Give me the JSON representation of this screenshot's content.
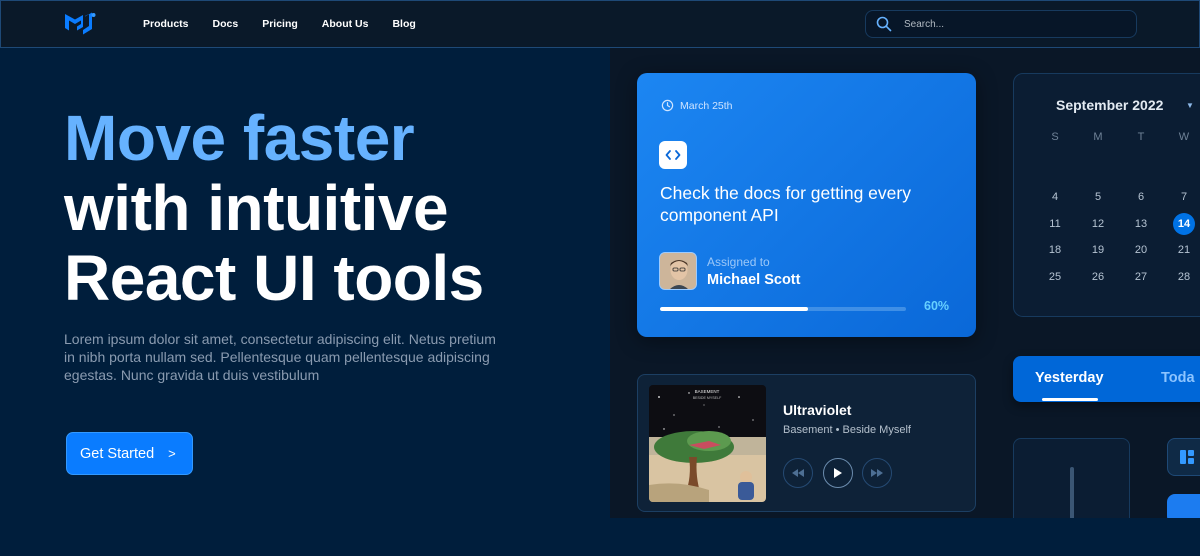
{
  "colors": {
    "background": "#001e3c",
    "accent": "#66b2ff",
    "primary": "#0a7cff",
    "header": "#0a1929"
  },
  "header": {
    "logo_icon": "mui-logo-icon",
    "nav": [
      "Products",
      "Docs",
      "Pricing",
      "About Us",
      "Blog"
    ],
    "search": {
      "icon": "search-icon",
      "placeholder": "Search..."
    }
  },
  "hero": {
    "title_line_1": "Move faster",
    "title_line_2": "with intuitive",
    "title_line_3": "React UI tools",
    "description": "Lorem ipsum dolor sit amet, consectetur adipiscing elit. Netus pretium in nibh porta nullam sed. Pellentesque quam pellentesque adipiscing egestas. Nunc gravida ut duis vestibulum",
    "cta_label": "Get Started",
    "cta_chevron": ">"
  },
  "task_card": {
    "date_icon": "clock-icon",
    "date": "March 25th",
    "code_icon": "code-icon",
    "title": "Check the docs for getting every component API",
    "assigned_label": "Assigned to",
    "assignee": "Michael Scott",
    "progress_value": 0.6,
    "progress_label": "60%"
  },
  "calendar": {
    "month_label": "September 2022",
    "weekdays": [
      "S",
      "M",
      "T",
      "W"
    ],
    "weeks": [
      [
        "4",
        "5",
        "6",
        "7"
      ],
      [
        "11",
        "12",
        "13",
        "14"
      ],
      [
        "18",
        "19",
        "20",
        "21"
      ],
      [
        "25",
        "26",
        "27",
        "28"
      ]
    ],
    "selected_day": "14"
  },
  "player": {
    "cover_text_1": "BASEMENT",
    "cover_text_2": "BESIDE MYSELF",
    "title": "Ultraviolet",
    "subtitle": "Basement • Beside Myself",
    "controls": [
      "rewind-icon",
      "play-icon",
      "fast-forward-icon"
    ]
  },
  "tabs": {
    "active": "Yesterday",
    "next": "Toda"
  }
}
